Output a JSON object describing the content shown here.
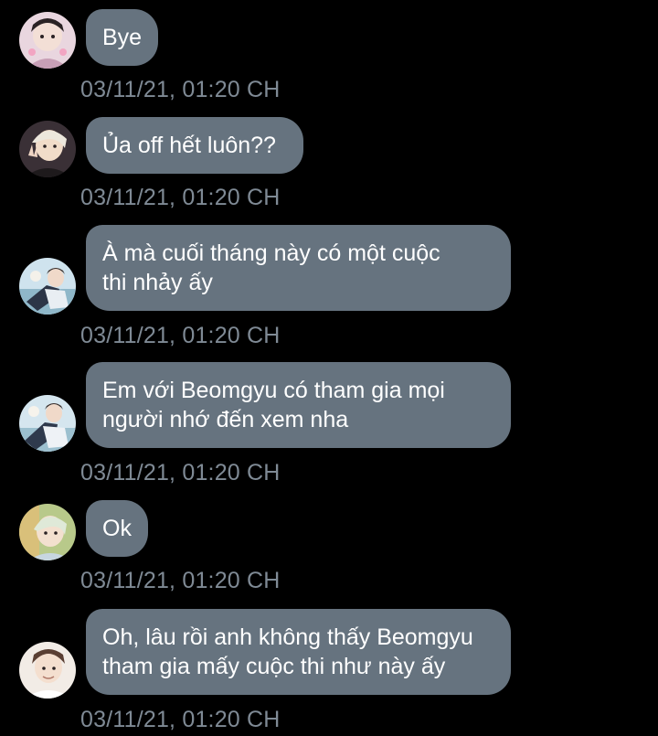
{
  "colors": {
    "background": "#000000",
    "bubble": "#66737f",
    "bubble_text": "#ffffff",
    "timestamp": "#7f8a95"
  },
  "messages": [
    {
      "lines": [
        "Bye"
      ],
      "time": "03/11/21, 01:20 CH",
      "avatar": "user-avatar-1"
    },
    {
      "lines": [
        "Ủa off hết luôn??"
      ],
      "time": "03/11/21, 01:20 CH",
      "avatar": "user-avatar-2"
    },
    {
      "lines": [
        "À mà cuối tháng này có một cuộc",
        "thi nhảy ấy"
      ],
      "time": "03/11/21, 01:20 CH",
      "avatar": "user-avatar-3"
    },
    {
      "lines": [
        "Em với Beomgyu có tham gia mọi",
        "người nhớ đến xem nha"
      ],
      "time": "03/11/21, 01:20 CH",
      "avatar": "user-avatar-3"
    },
    {
      "lines": [
        "Ok"
      ],
      "time": "03/11/21, 01:20 CH",
      "avatar": "user-avatar-4"
    },
    {
      "lines": [
        "Oh, lâu rồi anh không thấy Beomgyu",
        "tham gia mấy cuộc thi như này ấy"
      ],
      "time": "03/11/21, 01:20 CH",
      "avatar": "user-avatar-5"
    }
  ]
}
